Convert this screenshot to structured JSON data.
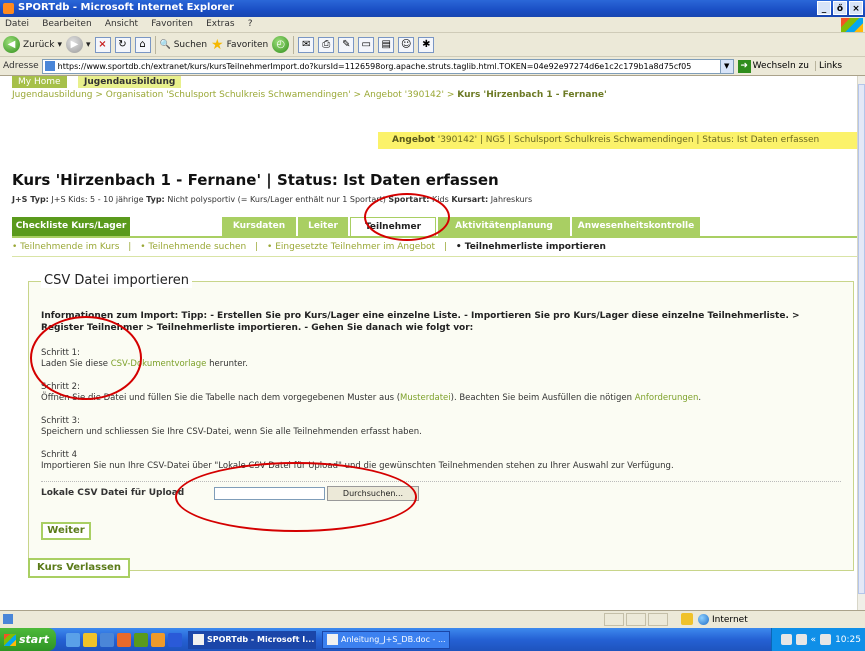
{
  "window": {
    "title": "SPORTdb - Microsoft Internet Explorer",
    "controls": [
      "_",
      "ő",
      "×"
    ]
  },
  "menu": [
    "Datei",
    "Bearbeiten",
    "Ansicht",
    "Favoriten",
    "Extras",
    "?"
  ],
  "toolbar": {
    "back": "Zurück",
    "search": "Suchen",
    "favorites": "Favoriten"
  },
  "address": {
    "label": "Adresse",
    "url": "https://www.sportdb.ch/extranet/kurs/kursTeilnehmerImport.do?kursId=1126598org.apache.struts.taglib.html.TOKEN=04e92e97274d6e1c2c179b1a8d75cf05",
    "go": "Wechseln zu",
    "links": "Links"
  },
  "page": {
    "topnav": {
      "home": "My Home",
      "active": "Jugendausbildung"
    },
    "breadcrumb": {
      "part1": "Jugendausbildung",
      "sep": ">",
      "part2": "Organisation 'Schulsport Schulkreis Schwamendingen'",
      "part3": "Angebot '390142'",
      "current": "Kurs 'Hirzenbach 1 - Fernane'"
    },
    "offer_bar": {
      "label": "Angebot",
      "text": "'390142' | NG5 | Schulsport Schulkreis Schwamendingen | Status: Ist Daten erfassen"
    },
    "course_title": "Kurs 'Hirzenbach 1 - Fernane' | Status: Ist Daten erfassen",
    "course_meta": {
      "type_label": "J+S Typ:",
      "type_value": "J+S Kids: 5 - 10 jährige",
      "typ_label": "Typ:",
      "typ_value": "Nicht polysportiv (= Kurs/Lager enthält nur 1 Sportart)",
      "sport_label": "Sportart:",
      "sport_value": "Kids",
      "kursart_label": "Kursart:",
      "kursart_value": "Jahreskurs"
    },
    "tabs": [
      "Checkliste Kurs/Lager",
      "Kursdaten",
      "Leiter",
      "Teilnehmer",
      "Aktivitätenplanung",
      "Anwesenheitskontrolle"
    ],
    "subnav": [
      "• Teilnehmende im Kurs",
      "|",
      "• Teilnehmende suchen",
      "|",
      "• Eingesetzte Teilnehmer im Angebot",
      "|",
      "• Teilnehmerliste importieren"
    ],
    "panel": {
      "legend": "CSV Datei importieren",
      "info": "Informationen zum Import: Tipp: - Erstellen Sie pro Kurs/Lager eine einzelne Liste. - Importieren Sie pro Kurs/Lager diese einzelne Teilnehmerliste. > Register Teilnehmer > Teilnehmerliste importieren. - Gehen Sie danach wie folgt vor:",
      "step1_title": "Schritt 1:",
      "step1_pre": "Laden Sie diese ",
      "step1_link": "CSV-Dokumentvorlage",
      "step1_post": " herunter.",
      "step2_title": "Schritt 2:",
      "step2_pre": "Öffnen Sie die Datei und füllen Sie die Tabelle nach dem vorgegebenen Muster aus (",
      "step2_link1": "Musterdatei",
      "step2_mid": "). Beachten Sie beim Ausfüllen die nötigen ",
      "step2_link2": "Anforderungen",
      "step2_post": ".",
      "step3_title": "Schritt 3:",
      "step3_text": "Speichern und schliessen Sie Ihre CSV-Datei, wenn Sie alle Teilnehmenden erfasst haben.",
      "step4_title": "Schritt 4",
      "step4_text": "Importieren Sie nun Ihre CSV-Datei über \"Lokale CSV Datei für Upload\" und die gewünschten Teilnehmenden stehen zu Ihrer Auswahl zur Verfügung.",
      "upload_label": "Lokale CSV Datei für Upload",
      "browse": "Durchsuchen..."
    },
    "btn_next": "Weiter",
    "btn_leave": "Kurs Verlassen"
  },
  "statusbar": {
    "zone": "Internet"
  },
  "taskbar": {
    "start": "start",
    "tasks": [
      "SPORTdb - Microsoft I...",
      "Anleitung_J+S_DB.doc - ..."
    ],
    "clock": "10:25"
  },
  "colors": {
    "accent_green": "#a9cf63",
    "annotation_red": "#d40000"
  }
}
